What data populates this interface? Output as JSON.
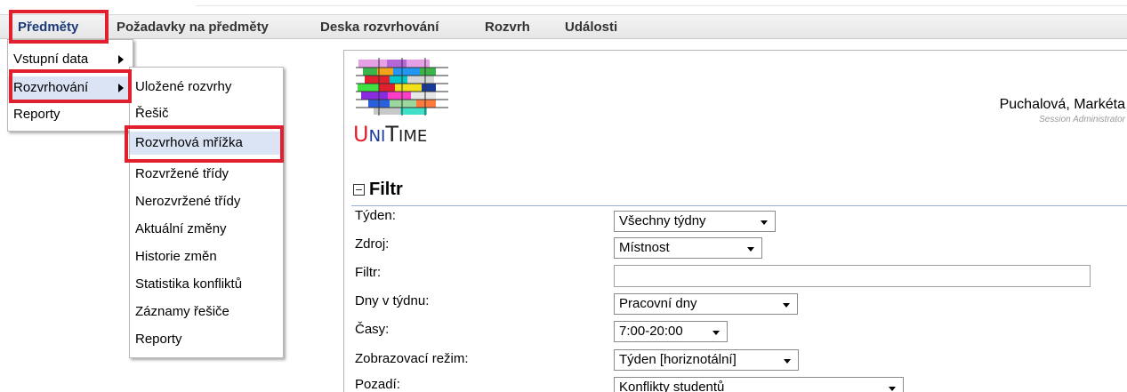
{
  "menubar": {
    "items": [
      "Předměty",
      "Požadavky na předměty",
      "Deska rozvrhování",
      "Rozvrh",
      "Události"
    ]
  },
  "predmety_menu": {
    "items": [
      {
        "label": "Vstupní data",
        "has_submenu": true
      },
      {
        "label": "Rozvrhování",
        "has_submenu": true
      },
      {
        "label": "Reporty",
        "has_submenu": false
      }
    ]
  },
  "rozvrhovani_menu": {
    "items": [
      "Uložené rozvrhy",
      "Řešič",
      "Rozvrhová mřížka",
      "Rozvržené třídy",
      "Nerozvržené třídy",
      "Aktuální změny",
      "Historie změn",
      "Statistika konfliktů",
      "Záznamy řešiče",
      "Reporty"
    ],
    "highlighted": "Rozvrhová mřížka"
  },
  "header": {
    "logo_text": {
      "u": "U",
      "ni": "NI",
      "t": "T",
      "ime": "IME"
    },
    "user_name": "Puchalová, Markéta",
    "user_role": "Session Administrator"
  },
  "filter": {
    "title": "Filtr",
    "fields": {
      "week": {
        "label": "Týden:",
        "value": "Všechny týdny"
      },
      "resource": {
        "label": "Zdroj:",
        "value": "Místnost"
      },
      "filter": {
        "label": "Filtr:",
        "value": ""
      },
      "days": {
        "label": "Dny v týdnu:",
        "value": "Pracovní dny"
      },
      "times": {
        "label": "Časy:",
        "value": "7:00-20:00"
      },
      "display_mode": {
        "label": "Zobrazovací režim:",
        "value": "Týden [horiznotální]"
      },
      "background": {
        "label": "Pozadí:",
        "value": "Konflikty studentů"
      }
    }
  },
  "colors": {
    "highlight_box": "#e0202c",
    "menu_highlight": "#dbe4f5",
    "accent_blue": "#1a3a9a"
  }
}
